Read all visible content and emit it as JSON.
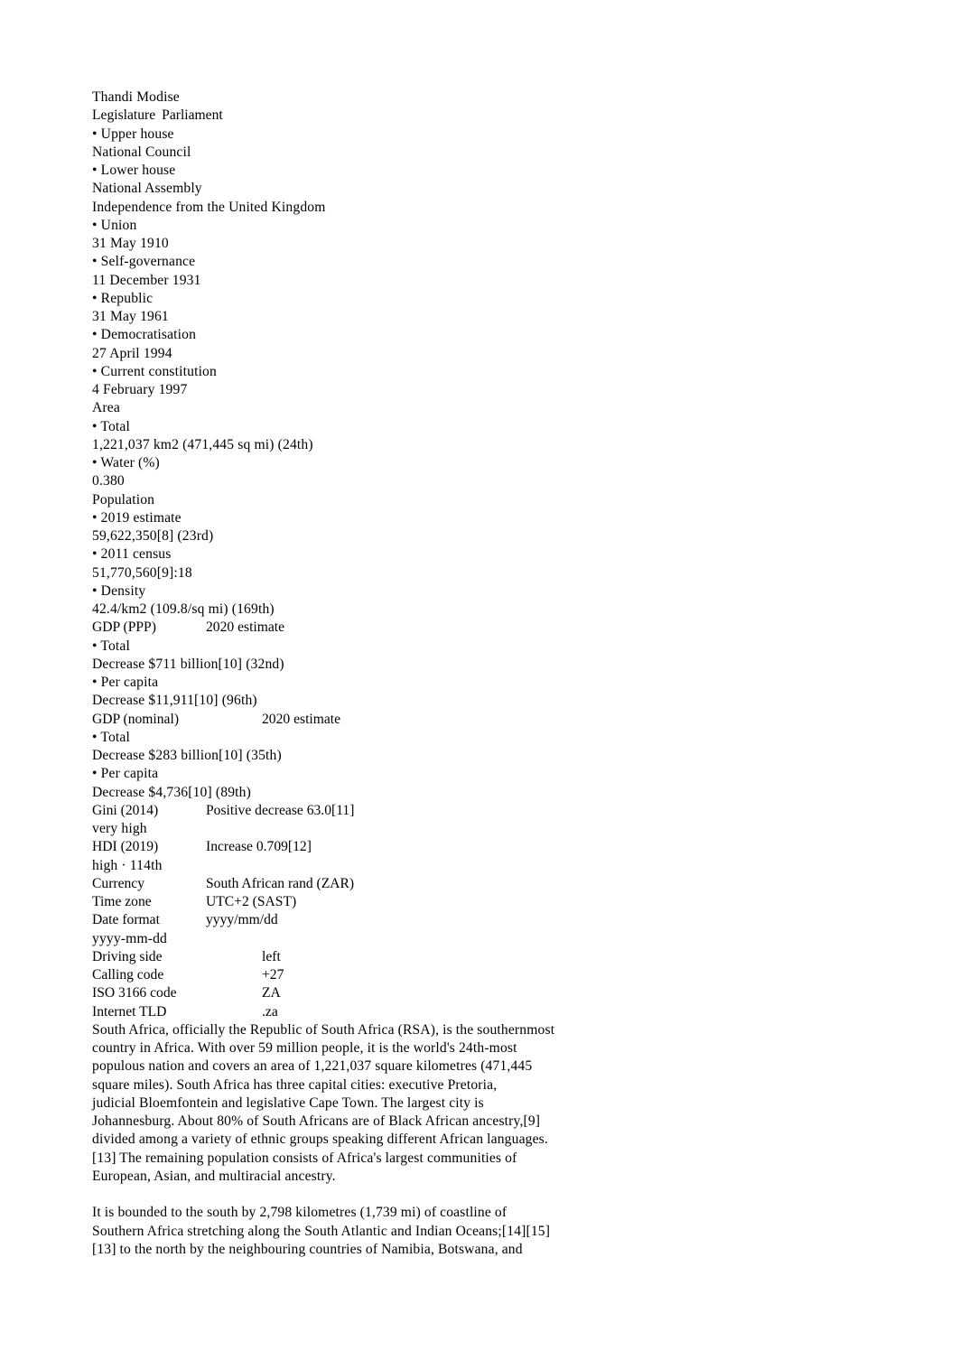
{
  "document": {
    "background_color": "#ffffff",
    "text_color": "#000000"
  },
  "infobox": {
    "lines": [
      {
        "id": "speaker-name",
        "type": "plain",
        "text": "Thandi Modise"
      },
      {
        "id": "legislature",
        "type": "kv",
        "tab": "tight",
        "key": "Legislature",
        "value": "Parliament"
      },
      {
        "id": "upper-house-label",
        "type": "plain",
        "text": "• Upper house"
      },
      {
        "id": "upper-house-value",
        "type": "plain",
        "text": "National Council"
      },
      {
        "id": "lower-house-label",
        "type": "plain",
        "text": "• Lower house"
      },
      {
        "id": "lower-house-value",
        "type": "plain",
        "text": "National Assembly"
      },
      {
        "id": "independence-heading",
        "type": "plain",
        "text": "Independence from the United Kingdom"
      },
      {
        "id": "union-label",
        "type": "plain",
        "text": "• Union"
      },
      {
        "id": "union-date",
        "type": "plain",
        "text": "31 May 1910"
      },
      {
        "id": "self-governance-label",
        "type": "plain",
        "text": "• Self-governance"
      },
      {
        "id": "self-governance-date",
        "type": "plain",
        "text": "11 December 1931"
      },
      {
        "id": "republic-label",
        "type": "plain",
        "text": "• Republic"
      },
      {
        "id": "republic-date",
        "type": "plain",
        "text": "31 May 1961"
      },
      {
        "id": "democratisation-label",
        "type": "plain",
        "text": "• Democratisation"
      },
      {
        "id": "democratisation-date",
        "type": "plain",
        "text": "27 April 1994"
      },
      {
        "id": "constitution-label",
        "type": "plain",
        "text": "• Current constitution"
      },
      {
        "id": "constitution-date",
        "type": "plain",
        "text": "4 February 1997"
      },
      {
        "id": "area-heading",
        "type": "plain",
        "text": "Area"
      },
      {
        "id": "area-total-label",
        "type": "plain",
        "text": "• Total"
      },
      {
        "id": "area-total-value",
        "type": "plain",
        "text": "1,221,037 km2 (471,445 sq mi) (24th)"
      },
      {
        "id": "area-water-label",
        "type": "plain",
        "text": "• Water (%)"
      },
      {
        "id": "area-water-value",
        "type": "plain",
        "text": "0.380"
      },
      {
        "id": "population-heading",
        "type": "plain",
        "text": "Population"
      },
      {
        "id": "pop-2019-label",
        "type": "plain",
        "text": "• 2019 estimate"
      },
      {
        "id": "pop-2019-value",
        "type": "plain",
        "text": "59,622,350[8] (23rd)"
      },
      {
        "id": "pop-2011-label",
        "type": "plain",
        "text": "• 2011 census"
      },
      {
        "id": "pop-2011-value",
        "type": "plain",
        "text": "51,770,560[9]:18"
      },
      {
        "id": "pop-density-label",
        "type": "plain",
        "text": "• Density"
      },
      {
        "id": "pop-density-value",
        "type": "plain",
        "text": "42.4/km2 (109.8/sq mi) (169th)"
      },
      {
        "id": "gdp-ppp",
        "type": "kv",
        "tab": "a",
        "key": "GDP (PPP)",
        "value": "2020 estimate"
      },
      {
        "id": "gdp-ppp-total-label",
        "type": "plain",
        "text": "• Total"
      },
      {
        "id": "gdp-ppp-total-value",
        "type": "plain",
        "text": "Decrease $711 billion[10] (32nd)"
      },
      {
        "id": "gdp-ppp-capita-label",
        "type": "plain",
        "text": "• Per capita"
      },
      {
        "id": "gdp-ppp-capita-value",
        "type": "plain",
        "text": "Decrease $11,911[10] (96th)"
      },
      {
        "id": "gdp-nominal",
        "type": "kv",
        "tab": "b",
        "key": "GDP (nominal)",
        "value": "2020 estimate"
      },
      {
        "id": "gdp-nom-total-label",
        "type": "plain",
        "text": "• Total"
      },
      {
        "id": "gdp-nom-total-value",
        "type": "plain",
        "text": "Decrease $283 billion[10] (35th)"
      },
      {
        "id": "gdp-nom-capita-label",
        "type": "plain",
        "text": "• Per capita"
      },
      {
        "id": "gdp-nom-capita-value",
        "type": "plain",
        "text": "Decrease $4,736[10] (89th)"
      },
      {
        "id": "gini",
        "type": "kv",
        "tab": "a",
        "key": "Gini (2014)",
        "value": "Positive decrease 63.0[11]"
      },
      {
        "id": "gini-rating",
        "type": "plain",
        "text": "very high"
      },
      {
        "id": "hdi",
        "type": "kv",
        "tab": "a",
        "key": "HDI (2019)",
        "value": "Increase 0.709[12]"
      },
      {
        "id": "hdi-rating",
        "type": "plain",
        "text": "high · 114th"
      },
      {
        "id": "currency",
        "type": "kv",
        "tab": "a",
        "key": "Currency",
        "value": "South African rand (ZAR)"
      },
      {
        "id": "time-zone",
        "type": "kv",
        "tab": "a",
        "key": "Time zone",
        "value": "UTC+2 (SAST)"
      },
      {
        "id": "date-format",
        "type": "kv",
        "tab": "a",
        "key": "Date format",
        "value": "yyyy/mm/dd"
      },
      {
        "id": "date-format-alt",
        "type": "plain",
        "text": "yyyy-mm-dd"
      },
      {
        "id": "driving-side",
        "type": "kv",
        "tab": "b",
        "key": "Driving side",
        "value": "left"
      },
      {
        "id": "calling-code",
        "type": "kv",
        "tab": "b",
        "key": "Calling code",
        "value": "+27"
      },
      {
        "id": "iso-3166-code",
        "type": "kv",
        "tab": "b",
        "key": "ISO 3166 code",
        "value": "ZA"
      },
      {
        "id": "internet-tld",
        "type": "kv",
        "tab": "b",
        "key": "Internet TLD",
        "value": ".za"
      }
    ]
  },
  "body": {
    "paragraphs": [
      {
        "id": "intro-paragraph",
        "lines": [
          "South Africa, officially the Republic of South Africa (RSA), is the southernmost",
          "country in Africa. With over 59 million people, it is the world's 24th-most",
          "populous nation and covers an area of 1,221,037 square kilometres (471,445",
          "square miles). South Africa has three capital cities: executive Pretoria,",
          "judicial Bloemfontein and legislative Cape Town. The largest city is",
          "Johannesburg. About 80% of South Africans are of Black African ancestry,[9]",
          "divided among a variety of ethnic groups speaking different African languages.",
          "[13] The remaining population consists of Africa's largest communities of",
          "European, Asian, and multiracial ancestry."
        ]
      },
      {
        "id": "geography-paragraph",
        "lines": [
          "It is bounded to the south by 2,798 kilometres (1,739 mi) of coastline of",
          "Southern Africa stretching along the South Atlantic and Indian Oceans;[14][15]",
          "[13] to the north by the neighbouring countries of Namibia, Botswana, and"
        ]
      }
    ]
  }
}
